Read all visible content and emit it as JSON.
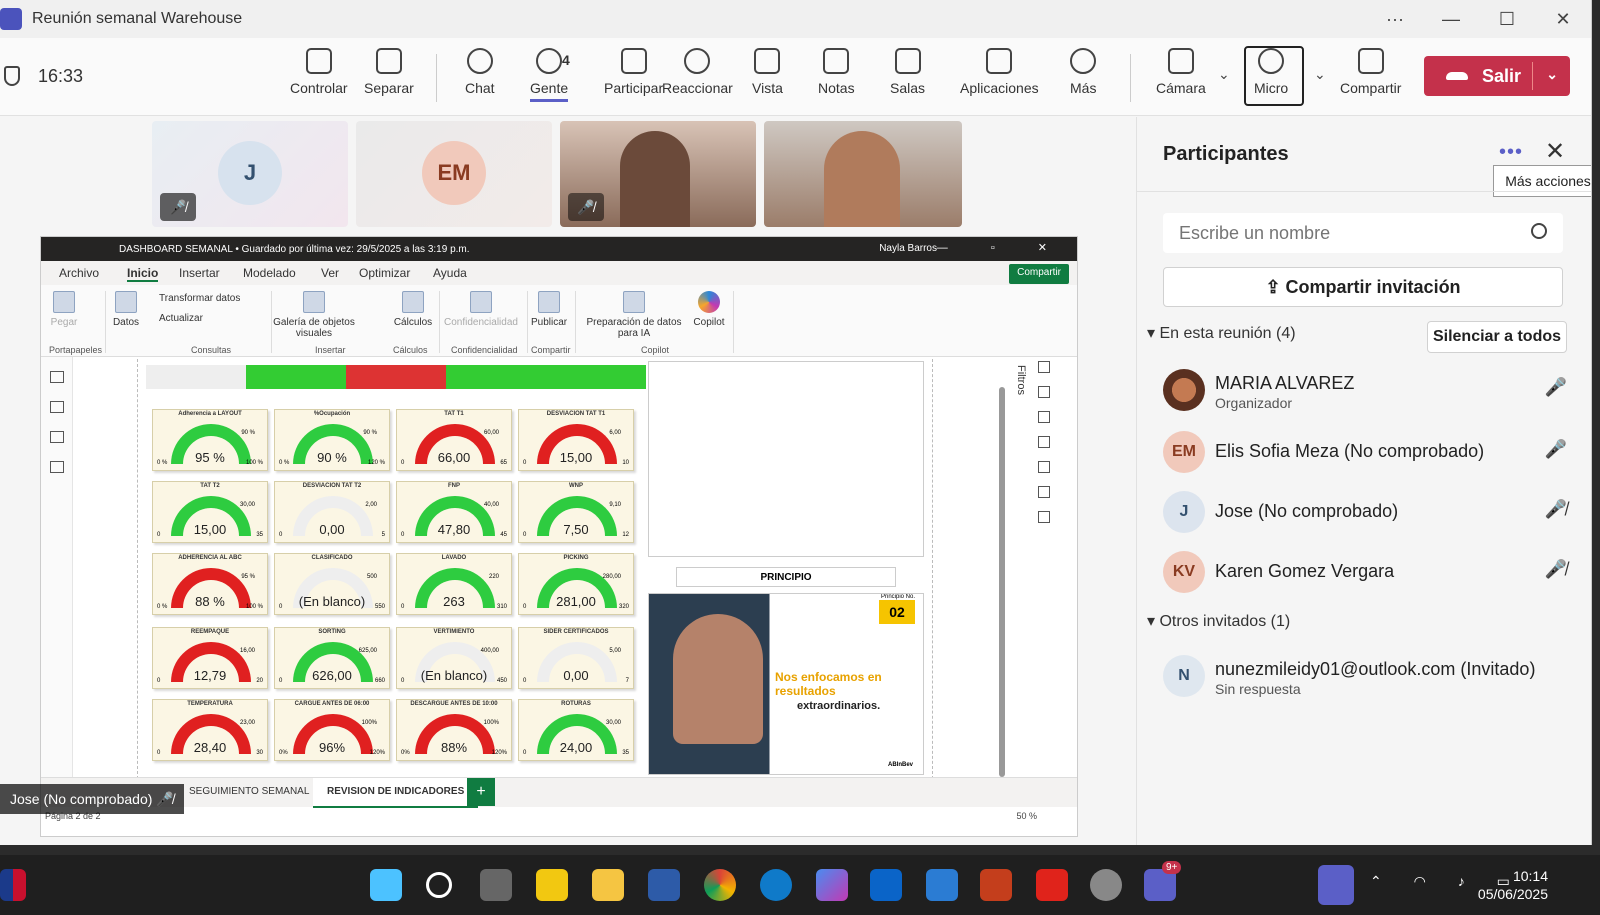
{
  "window": {
    "title": "Reunión semanal Warehouse",
    "controls": [
      "···",
      "—",
      "☐",
      "✕"
    ]
  },
  "toolbar": {
    "time": "16:33",
    "buttons": [
      {
        "label": "Controlar"
      },
      {
        "label": "Separar"
      },
      {
        "label": "Chat"
      },
      {
        "label": "Gente",
        "count": "4"
      },
      {
        "label": "Participar"
      },
      {
        "label": "Reaccionar"
      },
      {
        "label": "Vista"
      },
      {
        "label": "Notas"
      },
      {
        "label": "Salas"
      },
      {
        "label": "Aplicaciones"
      },
      {
        "label": "Más"
      },
      {
        "label": "Cámara"
      },
      {
        "label": "Micro"
      },
      {
        "label": "Compartir"
      }
    ],
    "leave_label": "Salir"
  },
  "tiles": [
    {
      "initials": "J"
    },
    {
      "initials": "EM"
    },
    {
      "type": "video"
    },
    {
      "type": "video"
    }
  ],
  "shared": {
    "pbi_title": "DASHBOARD SEMANAL • Guardado por última vez: 29/5/2025 a las 3:19 p.m.",
    "pbi_user": "Nayla Barros",
    "menu": [
      "Archivo",
      "Inicio",
      "Insertar",
      "Modelado",
      "Ver",
      "Optimizar",
      "Ayuda"
    ],
    "share_btn": "Compartir",
    "ribbon": {
      "pegar": "Pegar",
      "datos": "Datos",
      "transformar": "Transformar datos",
      "actualizar": "Actualizar",
      "galeria": "Galería de objetos visuales",
      "calculos": "Cálculos",
      "confidencialidad": "Confidencialidad",
      "publicar": "Publicar",
      "prep": "Preparación de datos para IA",
      "copilot": "Copilot",
      "groups": [
        "Portapapeles",
        "Consultas",
        "Insertar",
        "Cálculos",
        "Confidencialidad",
        "Compartir",
        "Copilot"
      ]
    },
    "gauges": [
      {
        "title": "Adherencia a LAYOUT",
        "value": "95 %",
        "min": "0 %",
        "max": "100 %",
        "target": "90 %",
        "color": "#2ecc40"
      },
      {
        "title": "%Ocupación",
        "value": "90 %",
        "min": "0 %",
        "max": "120 %",
        "target": "90 %",
        "color": "#2ecc40"
      },
      {
        "title": "TAT T1",
        "value": "66,00",
        "min": "0",
        "max": "65",
        "target": "60,00",
        "color": "#e02020"
      },
      {
        "title": "DESVIACION TAT T1",
        "value": "15,00",
        "min": "0",
        "max": "10",
        "target": "6,00",
        "color": "#e02020"
      },
      {
        "title": "TAT T2",
        "value": "15,00",
        "min": "0",
        "max": "35",
        "target": "30,00",
        "color": "#2ecc40"
      },
      {
        "title": "DESVIACION TAT T2",
        "value": "0,00",
        "min": "0",
        "max": "5",
        "target": "2,00",
        "color": "#eee"
      },
      {
        "title": "FNP",
        "value": "47,80",
        "min": "0",
        "max": "45",
        "target": "40,00",
        "color": "#2ecc40"
      },
      {
        "title": "WNP",
        "value": "7,50",
        "min": "0",
        "max": "12",
        "target": "9,10",
        "color": "#2ecc40"
      },
      {
        "title": "ADHERENCIA AL ABC",
        "value": "88 %",
        "min": "0 %",
        "max": "100 %",
        "target": "95 %",
        "color": "#e02020"
      },
      {
        "title": "CLASIFICADO",
        "value": "(En blanco)",
        "min": "0",
        "max": "550",
        "target": "500",
        "color": "#eee"
      },
      {
        "title": "LAVADO",
        "value": "263",
        "min": "0",
        "max": "310",
        "target": "220",
        "color": "#2ecc40"
      },
      {
        "title": "PICKING",
        "value": "281,00",
        "min": "0",
        "max": "320",
        "target": "280,00",
        "color": "#2ecc40"
      },
      {
        "title": "REEMPAQUE",
        "value": "12,79",
        "min": "0",
        "max": "20",
        "target": "16,00",
        "color": "#e02020"
      },
      {
        "title": "SORTING",
        "value": "626,00",
        "min": "0",
        "max": "660",
        "target": "625,00",
        "color": "#2ecc40"
      },
      {
        "title": "VERTIMIENTO",
        "value": "(En blanco)",
        "min": "0",
        "max": "450",
        "target": "400,00",
        "color": "#eee"
      },
      {
        "title": "SIDER CERTIFICADOS",
        "value": "0,00",
        "min": "0",
        "max": "7",
        "target": "5,00",
        "color": "#eee"
      },
      {
        "title": "TEMPERATURA",
        "value": "28,40",
        "min": "0",
        "max": "30",
        "target": "23,00",
        "color": "#e02020"
      },
      {
        "title": "CARGUE ANTES DE 06:00",
        "value": "96%",
        "min": "0%",
        "max": "120%",
        "target": "100%",
        "color": "#e02020"
      },
      {
        "title": "DESCARGUE ANTES DE 10:00",
        "value": "88%",
        "min": "0%",
        "max": "120%",
        "target": "100%",
        "color": "#e02020"
      },
      {
        "title": "ROTURAS",
        "value": "24,00",
        "min": "0",
        "max": "35",
        "target": "30,00",
        "color": "#2ecc40"
      }
    ],
    "principio_label": "PRINCIPIO",
    "poster": {
      "badge_top": "Principio No.",
      "badge": "02",
      "line1": "Nos enfocamos en resultados",
      "line2": "extraordinarios.",
      "brand": "ABInBev"
    },
    "filtros": "Filtros",
    "tabs": [
      "SEGUIMIENTO SEMANAL",
      "REVISION DE INDICADORES"
    ],
    "page": "Página 2 de 2",
    "zoom": "50 %"
  },
  "active_speaker": "Jose (No comprobado)",
  "panel": {
    "title": "Participantes",
    "tooltip": "Más acciones",
    "search_placeholder": "Escribe un nombre",
    "invite": "Compartir invitación",
    "in_meeting": "En esta reunión (4)",
    "mute_all": "Silenciar a todos",
    "people": [
      {
        "initials": "",
        "name": "MARIA ALVAREZ",
        "role": "Organizador",
        "mic": "on"
      },
      {
        "initials": "EM",
        "name": "Elis Sofia Meza (No comprobado)",
        "role": "",
        "mic": "on"
      },
      {
        "initials": "J",
        "name": "Jose (No comprobado)",
        "role": "",
        "mic": "off"
      },
      {
        "initials": "KV",
        "name": "Karen Gomez Vergara",
        "role": "",
        "mic": "off"
      }
    ],
    "others": "Otros invitados (1)",
    "guest": {
      "initials": "N",
      "name": "nunezmileidy01@outlook.com (Invitado)",
      "status": "Sin respuesta"
    }
  },
  "taskbar": {
    "time": "10:14",
    "date": "05/06/2025",
    "badge": "9+"
  }
}
